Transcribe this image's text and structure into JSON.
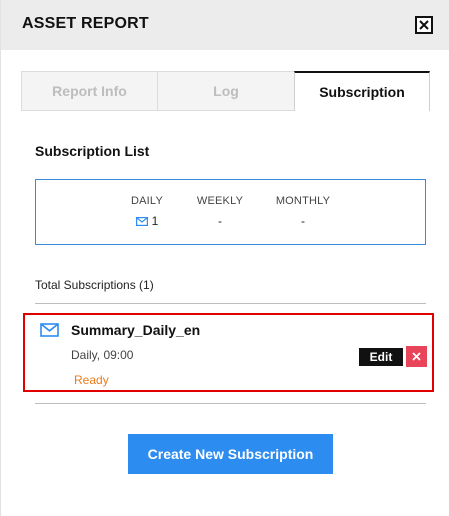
{
  "header": {
    "title": "ASSET REPORT"
  },
  "tabs": [
    {
      "label": "Report Info",
      "active": false
    },
    {
      "label": "Log",
      "active": false
    },
    {
      "label": "Subscription",
      "active": true
    }
  ],
  "subscription_list": {
    "title": "Subscription List",
    "columns": [
      {
        "label": "DAILY",
        "value": "1",
        "icon": "mail-icon"
      },
      {
        "label": "WEEKLY",
        "value": "-"
      },
      {
        "label": "MONTHLY",
        "value": "-"
      }
    ]
  },
  "total_label": "Total Subscriptions (1)",
  "subscriptions": [
    {
      "name": "Summary_Daily_en",
      "schedule": "Daily, 09:00",
      "status": "Ready",
      "icon": "mail-icon",
      "edit_label": "Edit"
    }
  ],
  "create_button": "Create New Subscription",
  "colors": {
    "accent_blue": "#2d8cf0",
    "box_border": "#3b8ad9",
    "status_orange": "#f07b1a",
    "highlight_red": "#e00000",
    "delete_red": "#e8455a",
    "header_bg": "#ececec"
  }
}
